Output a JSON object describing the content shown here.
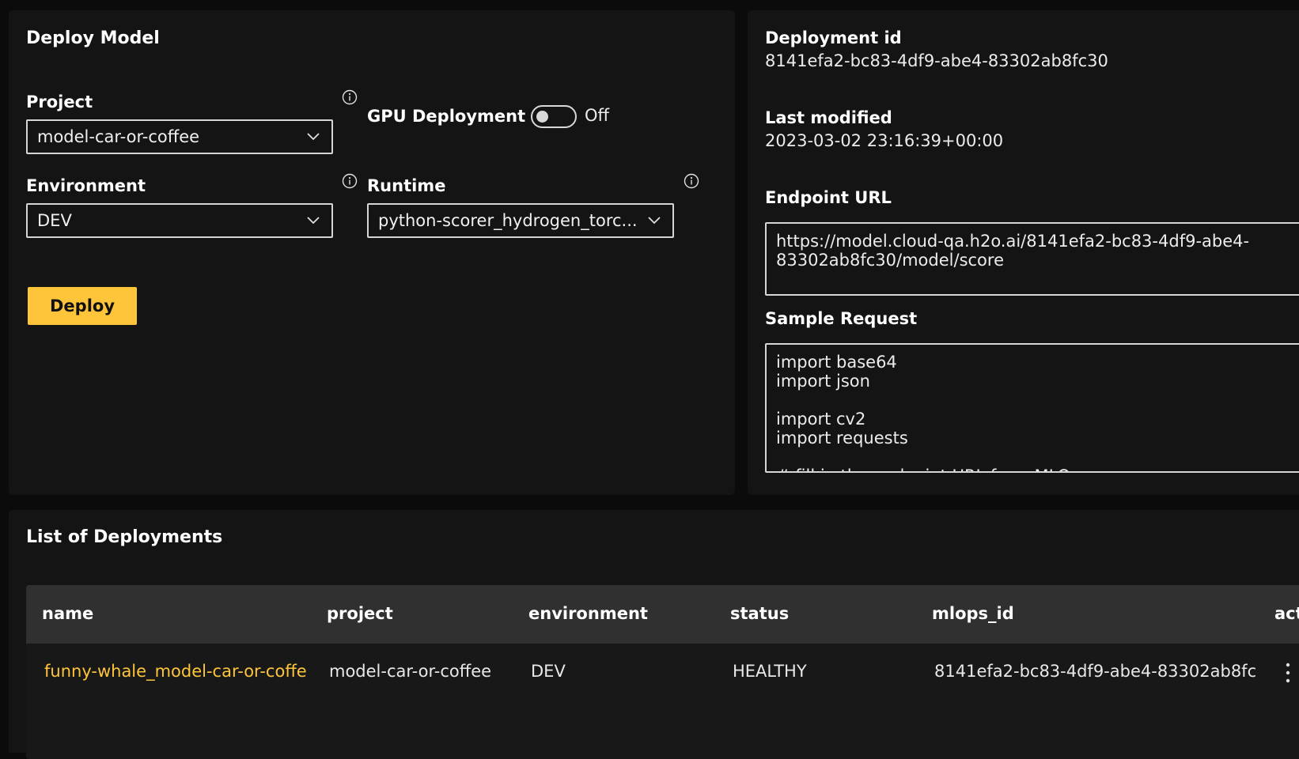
{
  "deploy_panel": {
    "title": "Deploy Model",
    "project": {
      "label": "Project",
      "value": "model-car-or-coffee"
    },
    "gpu": {
      "label": "GPU Deployment",
      "state_label": "Off"
    },
    "environment": {
      "label": "Environment",
      "value": "DEV"
    },
    "runtime": {
      "label": "Runtime",
      "value": "python-scorer_hydrogen_torc..."
    },
    "deploy_button": "Deploy"
  },
  "details_panel": {
    "deployment_id_label": "Deployment id",
    "deployment_id": "8141efa2-bc83-4df9-abe4-83302ab8fc30",
    "last_modified_label": "Last modified",
    "last_modified": "2023-03-02 23:16:39+00:00",
    "endpoint_label": "Endpoint URL",
    "endpoint_lines": [
      "https://model.cloud-qa.h2o.ai/8141efa2-bc83-4df9-abe4-",
      "83302ab8fc30/model/score"
    ],
    "sample_label": "Sample Request",
    "sample_lines": [
      "import base64",
      "import json",
      "",
      "import cv2",
      "import requests",
      "",
      "# fill in the endpoint URL from MLOps"
    ]
  },
  "deployments": {
    "title": "List of Deployments",
    "columns": [
      "name",
      "project",
      "environment",
      "status",
      "mlops_id",
      "act"
    ],
    "rows": [
      {
        "name": "funny-whale_model-car-or-coffe",
        "project": "model-car-or-coffee",
        "environment": "DEV",
        "status": "HEALTHY",
        "mlops_id": "8141efa2-bc83-4df9-abe4-83302ab8fc"
      }
    ]
  },
  "colors": {
    "accent": "#fec53a",
    "background": "#0b0b0b",
    "panel": "#141414",
    "table_header": "#303030"
  }
}
